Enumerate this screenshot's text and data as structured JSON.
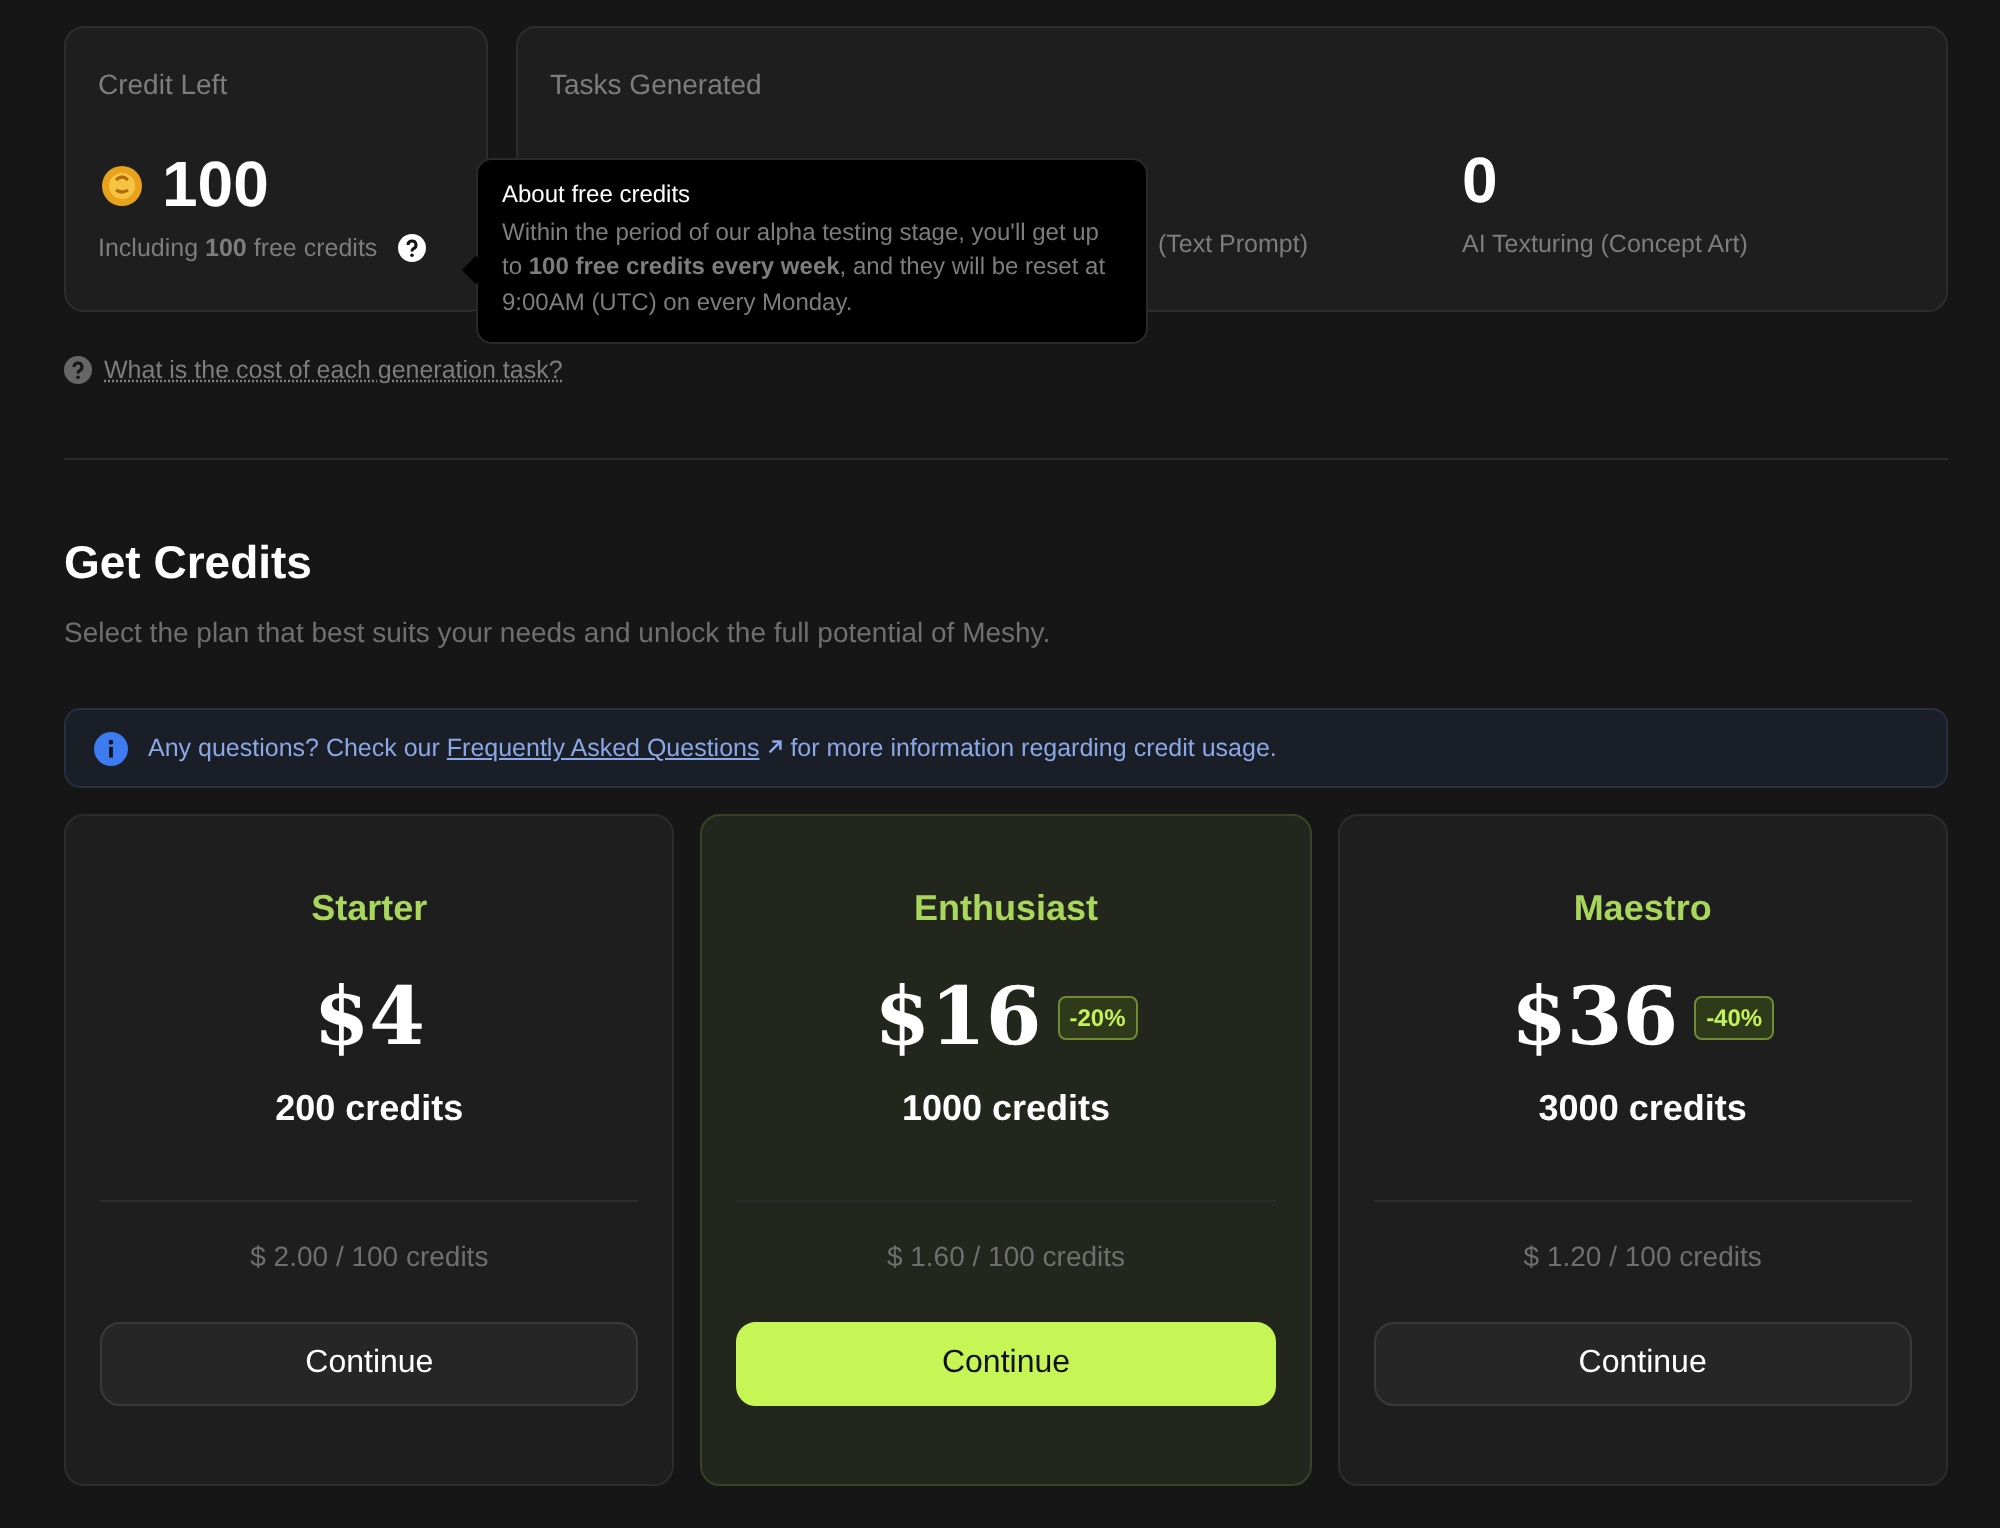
{
  "credit_card": {
    "title": "Credit Left",
    "amount": "100",
    "note": "Including **100** free credits"
  },
  "tasks_card": {
    "title": "Tasks Generated",
    "stats": [
      {
        "label": "(Text Prompt)"
      },
      {
        "value": "0",
        "label": "AI Texturing (Concept Art)"
      }
    ]
  },
  "tooltip": {
    "title": "About free credits",
    "body": "Within the period of our alpha testing stage, you'll get up to **100 free credits every week**, and they will be reset at 9:00AM (UTC) on every Monday."
  },
  "cost_link": "What is the cost of each generation task?",
  "get_credits": {
    "heading": "Get Credits",
    "subtitle": "Select the plan that best suits your needs and unlock the full potential of Meshy."
  },
  "notice": {
    "before": "Any questions? Check our",
    "link": "Frequently Asked Questions",
    "after": "for more information regarding credit usage."
  },
  "plans": [
    {
      "name": "Starter",
      "price": "$4",
      "credits": "200 credits",
      "unit_price": "$ 2.00 / 100 credits",
      "button": "Continue",
      "selected": false
    },
    {
      "name": "Enthusiast",
      "price": "$16",
      "discount": "-20%",
      "credits": "1000 credits",
      "unit_price": "$ 1.60 / 100 credits",
      "button": "Continue",
      "selected": true
    },
    {
      "name": "Maestro",
      "price": "$36",
      "discount": "-40%",
      "credits": "3000 credits",
      "unit_price": "$ 1.20 / 100 credits",
      "button": "Continue",
      "selected": false
    }
  ]
}
